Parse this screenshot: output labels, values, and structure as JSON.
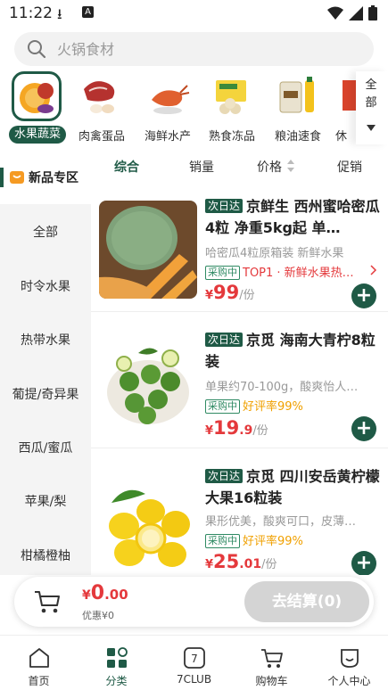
{
  "status": {
    "time": "11:22"
  },
  "search": {
    "placeholder": "火锅食材"
  },
  "categories": [
    {
      "label": "水果蔬菜",
      "active": true
    },
    {
      "label": "肉禽蛋品"
    },
    {
      "label": "海鲜水产"
    },
    {
      "label": "熟食冻品"
    },
    {
      "label": "粮油速食"
    },
    {
      "label": "休"
    }
  ],
  "all_button": {
    "label": "全部"
  },
  "new_zone": {
    "label": "新品专区"
  },
  "sort": {
    "items": [
      "综合",
      "销量",
      "价格",
      "促销"
    ]
  },
  "leftnav": {
    "items": [
      "全部",
      "时令水果",
      "热带水果",
      "葡提/奇异果",
      "西瓜/蜜瓜",
      "苹果/梨",
      "柑橘橙柚"
    ]
  },
  "products": [
    {
      "tag": "次日达",
      "title": "京鲜生  西州蜜哈密瓜 4粒 净重5kg起 单…",
      "sub": "哈密瓜4粒原箱装  新鲜水果",
      "promo_tag": "采购中",
      "promo_text": "TOP1 · 新鲜水果热…",
      "promo_color": "#e4393c",
      "price_currency": "¥",
      "price_int": "99",
      "price_dec": "",
      "price_unit": "/份"
    },
    {
      "tag": "次日达",
      "title": "京觅  海南大青柠8粒装",
      "sub": "单果约70-100g，酸爽怡人…",
      "promo_tag": "采购中",
      "promo_text": "好评率99%",
      "promo_color": "#f0a000",
      "price_currency": "¥",
      "price_int": "19",
      "price_dec": ".9",
      "price_unit": "/份"
    },
    {
      "tag": "次日达",
      "title": "京觅  四川安岳黄柠檬大果16粒装",
      "sub": "果形优美，酸爽可口，皮薄…",
      "promo_tag": "采购中",
      "promo_text": "好评率99%",
      "promo_color": "#f0a000",
      "price_currency": "¥",
      "price_int": "25",
      "price_dec": ".01",
      "price_unit": "/份"
    }
  ],
  "cart": {
    "currency": "¥",
    "amount_int": "0",
    "amount_dec": ".00",
    "discount": "优惠¥0",
    "checkout_label": "去结算(0)"
  },
  "tabs": [
    {
      "label": "首页"
    },
    {
      "label": "分类",
      "active": true
    },
    {
      "label": "7CLUB"
    },
    {
      "label": "购物车"
    },
    {
      "label": "个人中心"
    }
  ],
  "colors": {
    "brand": "#1f5a46",
    "price": "#e4393c"
  }
}
